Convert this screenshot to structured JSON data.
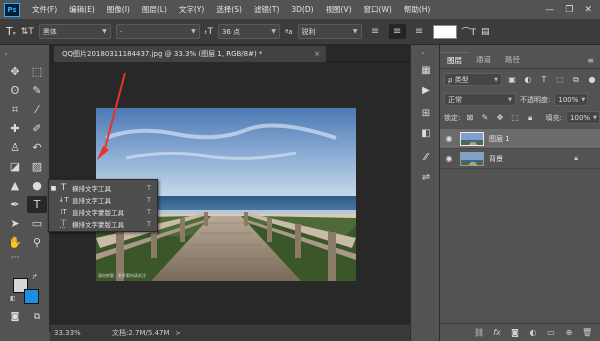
{
  "app": {
    "logo": "Ps",
    "brand_color": "#31a8ff"
  },
  "menu": [
    "文件(F)",
    "编辑(E)",
    "图像(I)",
    "图层(L)",
    "文字(Y)",
    "选择(S)",
    "滤镜(T)",
    "3D(D)",
    "视图(V)",
    "窗口(W)",
    "帮助(H)"
  ],
  "window_controls": {
    "minimize": "—",
    "restore": "❐",
    "close": "✕"
  },
  "options": {
    "font_family": "黑体",
    "font_style": "-",
    "font_size": "36 点",
    "aa_label": "ªa",
    "anti_alias": "锐利",
    "text_color": "#ffffff"
  },
  "document": {
    "tab_title": "QQ图片20180311184437.jpg @ 33.3% (图层 1, RGB/8#) *",
    "tab_close": "×",
    "watermark": "请勿转载 · 更多素材请关注"
  },
  "flyout": [
    {
      "label": "横排文字工具",
      "key": "T",
      "icon": "horizontal-type-icon",
      "glyph": "T",
      "current": true
    },
    {
      "label": "直排文字工具",
      "key": "T",
      "icon": "vertical-type-icon",
      "glyph": "↓T",
      "current": false
    },
    {
      "label": "直排文字蒙版工具",
      "key": "T",
      "icon": "vertical-type-mask-icon",
      "glyph": "⁞T",
      "current": false
    },
    {
      "label": "横排文字蒙版工具",
      "key": "T",
      "icon": "horizontal-type-mask-icon",
      "glyph": "T",
      "current": false
    }
  ],
  "status": {
    "zoom": "33.33%",
    "doc_info": "文档:2.7M/5.47M",
    "arrow": ">"
  },
  "layers_panel": {
    "tabs": [
      "图层",
      "通道",
      "路径"
    ],
    "filter_kind": "ρ 类型",
    "blend_mode": "正常",
    "opacity_label": "不透明度:",
    "opacity_value": "100%",
    "lock_label": "锁定:",
    "fill_label": "填充:",
    "fill_value": "100%",
    "layers": [
      {
        "name": "图层 1",
        "selected": true,
        "locked": false
      },
      {
        "name": "背景",
        "selected": false,
        "locked": true
      }
    ]
  },
  "colors": {
    "foreground": "#d8d8d8",
    "background": "#1a8fe3",
    "arrow": "#e8322a"
  }
}
